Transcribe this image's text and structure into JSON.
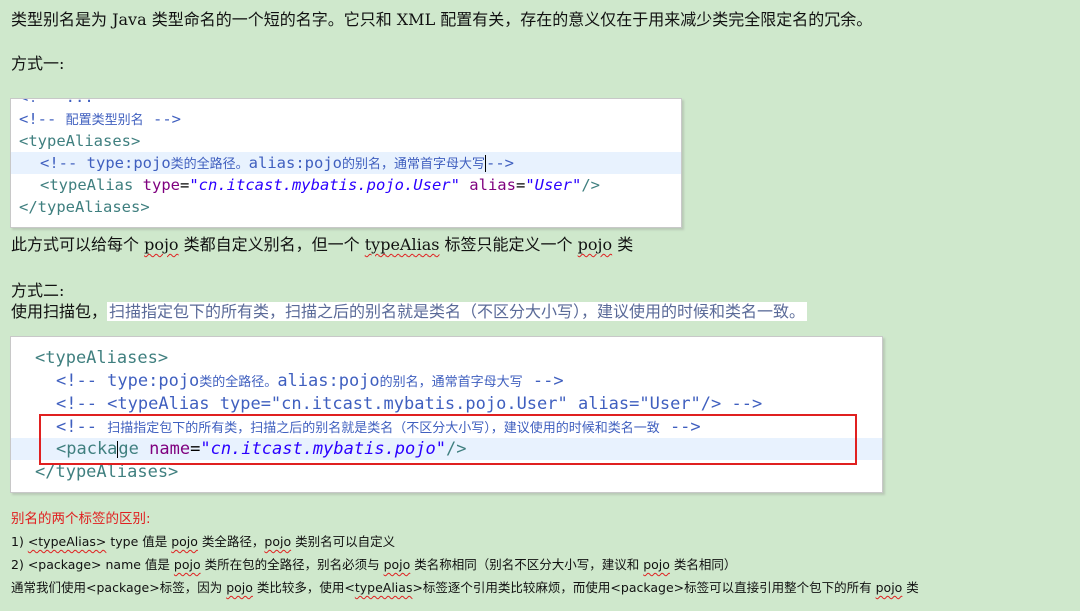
{
  "intro": "类型别名是为 Java 类型命名的一个短的名字。它只和 XML 配置有关，存在的意义仅在于用来减少类完全限定名的冗余。",
  "method1_title": "方式一:",
  "code1": {
    "cut_line": "<!-- ...",
    "l1_open": "<!-- ",
    "l1_cn": "配置类型别名",
    "l1_close": " -->",
    "l2": "<typeAliases>",
    "l3_a": "<!-- type:pojo",
    "l3_b": "类的全路径。",
    "l3_c": "alias:pojo",
    "l3_d": "的别名，通常首字母大写",
    "l3_e": "-->",
    "l4_tag": "<typeAlias ",
    "l4_attr1": "type",
    "l4_eq1": "=",
    "l4_val1": "\"cn.itcast.mybatis.pojo.User\"",
    "l4_attr2": "alias",
    "l4_eq2": "=",
    "l4_val2": "\"User\"",
    "l4_end": "/>",
    "l5": "</typeAliases>"
  },
  "method1_note": {
    "a": "此方式可以给每个 ",
    "b": "pojo",
    "c": " 类都自定义别名，但一个 ",
    "d": "typeAlias",
    "e": " 标签只能定义一个 ",
    "f": "pojo",
    "g": " 类"
  },
  "method2_title": "方式二:",
  "method2_desc": {
    "a": "使用扫描包，",
    "b": "扫描指定包下的所有类，扫描之后的别名就是类名（不区分大小写），建议使用的时候和类名一致。"
  },
  "code2": {
    "l1": "<typeAliases>",
    "l2_a": "<!-- type:pojo",
    "l2_b": "类的全路径。",
    "l2_c": "alias:pojo",
    "l2_d": "的别名，通常首字母大写",
    "l2_e": " -->",
    "l3": "<!-- <typeAlias type=\"cn.itcast.mybatis.pojo.User\" alias=\"User\"/> -->",
    "l4_a": "<!-- ",
    "l4_b": "扫描指定包下的所有类，扫描之后的别名就是类名（不区分大小写），建议使用的时候和类名一致",
    "l4_c": " -->",
    "l5_tag1": "<packa",
    "l5_tag2": "ge ",
    "l5_attr": "name",
    "l5_eq": "=",
    "l5_val": "\"cn.itcast.mybatis.pojo\"",
    "l5_end": "/>",
    "l6": "</typeAliases>"
  },
  "diff_title": "别名的两个标签的区别:",
  "diff1": {
    "num": "1)  ",
    "a": "<typeAlias>",
    "b": " type 值是 ",
    "c": "pojo",
    "d": " 类全路径，",
    "e": "pojo",
    "f": " 类别名可以自定义"
  },
  "diff2": {
    "num": "2)  ",
    "a": "<package> name 值是 ",
    "b": "pojo",
    "c": " 类所在包的全路径，别名必须与 ",
    "d": "pojo",
    "e": " 类名称相同（别名不区分大小写，建议和 ",
    "f": "pojo",
    "g": " 类名相同）"
  },
  "diff3": {
    "a": "通常我们使用<package>标签，因为 ",
    "b": "pojo",
    "c": " 类比较多，使用<",
    "d": "typeAlias",
    "e": ">标签逐个引用类比较麻烦，而使用<package>标签可以直接引用整个包下的所有 ",
    "f": "pojo",
    "g": " 类"
  },
  "colors": {
    "background": "#cfe8cc",
    "red": "#e02020",
    "comment": "#3f5fbf",
    "tag": "#3f7f7f",
    "attr": "#7f007f",
    "value": "#2a00ff"
  }
}
